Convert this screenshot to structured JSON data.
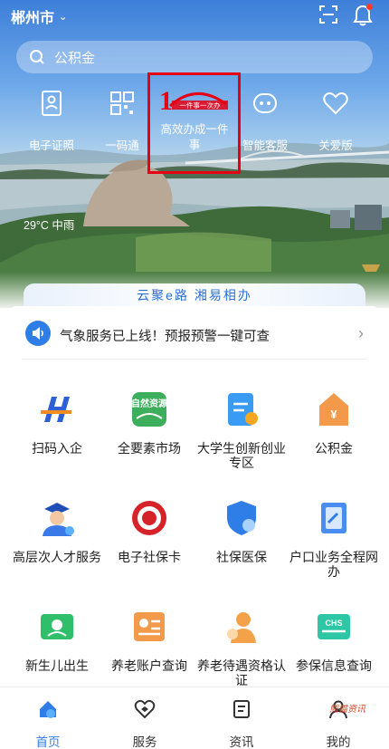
{
  "header": {
    "city": "郴州市"
  },
  "search": {
    "placeholder": "公积金"
  },
  "quick_nav": [
    {
      "label": "电子证照",
      "icon": "id-card-icon"
    },
    {
      "label": "一码通",
      "icon": "qr-code-icon"
    },
    {
      "label": "高效办成一件事",
      "icon": "one-thing-logo-icon",
      "logo_text": "一件事一次办"
    },
    {
      "label": "智能客服",
      "icon": "robot-icon"
    },
    {
      "label": "关爱版",
      "icon": "heart-icon"
    }
  ],
  "weather": "29°C 中雨",
  "slogan": "云聚e路 湘易相办",
  "notice": {
    "text": "气象服务已上线！预报预警一键可查"
  },
  "services": [
    {
      "label": "扫码入企",
      "icon": "h-logo-icon"
    },
    {
      "label": "全要素市场",
      "icon": "natural-resources-icon",
      "icon_text": "自然资源"
    },
    {
      "label": "大学生创新创业专区",
      "icon": "innovation-doc-icon"
    },
    {
      "label": "公积金",
      "icon": "housing-fund-icon",
      "icon_text": "¥"
    },
    {
      "label": "高层次人才服务",
      "icon": "talent-icon"
    },
    {
      "label": "电子社保卡",
      "icon": "social-security-card-icon"
    },
    {
      "label": "社保医保",
      "icon": "shield-insurance-icon"
    },
    {
      "label": "户口业务全程网办",
      "icon": "household-register-icon"
    },
    {
      "label": "新生儿出生",
      "icon": "newborn-icon"
    },
    {
      "label": "养老账户查询",
      "icon": "pension-account-icon"
    },
    {
      "label": "养老待遇资格认证",
      "icon": "pension-certify-icon"
    },
    {
      "label": "参保信息查询",
      "icon": "chs-insurance-icon",
      "icon_text": "CHS"
    }
  ],
  "tabs": [
    {
      "label": "首页",
      "icon": "home-icon",
      "active": true
    },
    {
      "label": "服务",
      "icon": "service-icon",
      "active": false
    },
    {
      "label": "资讯",
      "icon": "news-icon",
      "active": false
    },
    {
      "label": "我的",
      "icon": "profile-icon",
      "active": false
    }
  ],
  "watermark": "熊猫资讯",
  "colors": {
    "brand_blue": "#2f7ee8",
    "highlight_red": "#e60012",
    "notification_red": "#ff3b30"
  }
}
